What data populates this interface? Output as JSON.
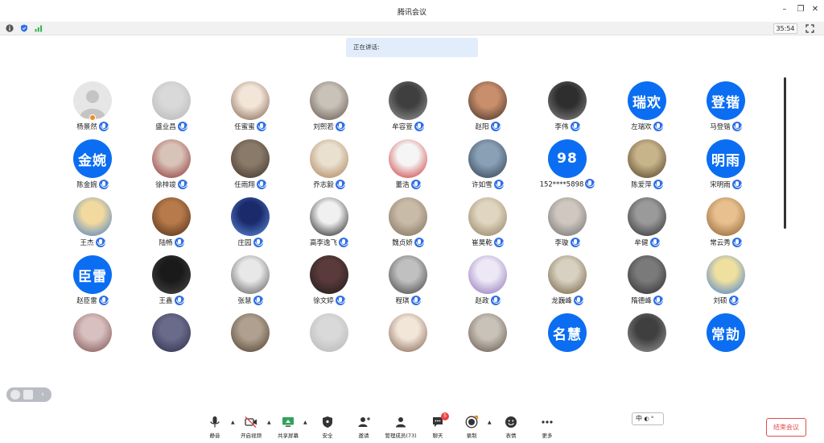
{
  "window": {
    "title": "腾讯会议"
  },
  "infobar": {
    "timer": "35:54"
  },
  "speaking_label": "正在讲话:",
  "participants": [
    {
      "name": "杨景然",
      "avatar": "default-person",
      "initials": ""
    },
    {
      "name": "盛业昌",
      "avatar": "photo",
      "initials": ""
    },
    {
      "name": "任蜜蜜",
      "avatar": "photo",
      "initials": ""
    },
    {
      "name": "刘熙若",
      "avatar": "photo",
      "initials": ""
    },
    {
      "name": "牟容萱",
      "avatar": "photo",
      "initials": ""
    },
    {
      "name": "赵阳",
      "avatar": "photo",
      "initials": ""
    },
    {
      "name": "李伟",
      "avatar": "photo",
      "initials": ""
    },
    {
      "name": "左瑞欢",
      "avatar": "initials",
      "initials": "瑞欢"
    },
    {
      "name": "马登锴",
      "avatar": "initials",
      "initials": "登锴"
    },
    {
      "name": "陈金婉",
      "avatar": "initials",
      "initials": "金婉"
    },
    {
      "name": "徐梓竣",
      "avatar": "photo",
      "initials": ""
    },
    {
      "name": "任雨翔",
      "avatar": "photo",
      "initials": ""
    },
    {
      "name": "乔志毅",
      "avatar": "photo",
      "initials": ""
    },
    {
      "name": "董浩",
      "avatar": "photo",
      "initials": ""
    },
    {
      "name": "许如雪",
      "avatar": "photo",
      "initials": ""
    },
    {
      "name": "152****5898",
      "avatar": "initials",
      "initials": "98"
    },
    {
      "name": "陈爱萍",
      "avatar": "photo",
      "initials": ""
    },
    {
      "name": "宋明雨",
      "avatar": "initials",
      "initials": "明雨"
    },
    {
      "name": "王杰",
      "avatar": "photo",
      "initials": ""
    },
    {
      "name": "陆畅",
      "avatar": "photo",
      "initials": ""
    },
    {
      "name": "庄园",
      "avatar": "photo",
      "initials": ""
    },
    {
      "name": "高李逸飞",
      "avatar": "photo",
      "initials": ""
    },
    {
      "name": "魏贞娇",
      "avatar": "photo",
      "initials": ""
    },
    {
      "name": "崔昊乾",
      "avatar": "photo",
      "initials": ""
    },
    {
      "name": "李璇",
      "avatar": "photo",
      "initials": ""
    },
    {
      "name": "牟健",
      "avatar": "photo",
      "initials": ""
    },
    {
      "name": "常云秀",
      "avatar": "photo",
      "initials": ""
    },
    {
      "name": "赵臣雷",
      "avatar": "initials",
      "initials": "臣雷"
    },
    {
      "name": "王鑫",
      "avatar": "photo",
      "initials": ""
    },
    {
      "name": "张慧",
      "avatar": "photo",
      "initials": ""
    },
    {
      "name": "徐文婷",
      "avatar": "photo",
      "initials": ""
    },
    {
      "name": "程琪",
      "avatar": "photo",
      "initials": ""
    },
    {
      "name": "赵政",
      "avatar": "photo",
      "initials": ""
    },
    {
      "name": "龙巍峰",
      "avatar": "photo",
      "initials": ""
    },
    {
      "name": "隋德峰",
      "avatar": "photo",
      "initials": ""
    },
    {
      "name": "刘硕",
      "avatar": "photo",
      "initials": ""
    },
    {
      "name": "",
      "avatar": "photo",
      "initials": ""
    },
    {
      "name": "",
      "avatar": "photo",
      "initials": ""
    },
    {
      "name": "",
      "avatar": "photo",
      "initials": ""
    },
    {
      "name": "",
      "avatar": "photo",
      "initials": ""
    },
    {
      "name": "",
      "avatar": "photo",
      "initials": ""
    },
    {
      "name": "",
      "avatar": "photo",
      "initials": ""
    },
    {
      "name": "",
      "avatar": "initials",
      "initials": "名慧"
    },
    {
      "name": "",
      "avatar": "photo",
      "initials": ""
    },
    {
      "name": "",
      "avatar": "initials",
      "initials": "常劼"
    }
  ],
  "toolbar": {
    "mute": "静音",
    "video": "开启视频",
    "share": "共享屏幕",
    "security": "安全",
    "invite": "邀请",
    "manage": "管理成员(73)",
    "chat": "聊天",
    "chat_badge": "5",
    "record": "录制",
    "emoji": "表情",
    "more": "更多"
  },
  "ime": {
    "label": "中"
  },
  "end_button": "结束会议",
  "colors": {
    "accent": "#0b6ef2",
    "end": "#e34b4b",
    "speaking_bg": "#e2edfc"
  }
}
